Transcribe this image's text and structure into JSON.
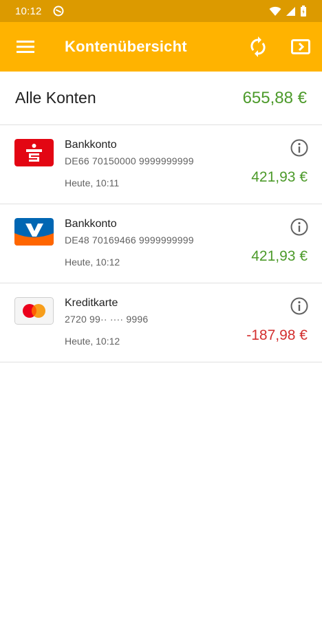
{
  "status_bar": {
    "time": "10:12",
    "icons": [
      "at-notification-icon",
      "wifi-icon",
      "signal-icon",
      "battery-icon"
    ]
  },
  "app_bar": {
    "title": "Kontenübersicht",
    "background": "#ffb300",
    "icons": [
      "menu-icon",
      "sync-icon",
      "export-icon"
    ]
  },
  "total": {
    "label": "Alle Konten",
    "amount": "655,88 €"
  },
  "accounts": [
    {
      "logo": "sparkasse-logo-icon",
      "name": "Bankkonto",
      "iban": "DE66 70150000 9999999999",
      "updated": "Heute, 10:11",
      "amount": "421,93 €",
      "amount_color": "#4c9a2a"
    },
    {
      "logo": "volksbank-logo-icon",
      "name": "Bankkonto",
      "iban": "DE48 70169466 9999999999",
      "updated": "Heute, 10:12",
      "amount": "421,93 €",
      "amount_color": "#4c9a2a"
    },
    {
      "logo": "mastercard-logo-icon",
      "name": "Kreditkarte",
      "iban": "2720 99·· ···· 9996",
      "updated": "Heute, 10:12",
      "amount": "-187,98 €",
      "amount_color": "#d32f2f"
    }
  ]
}
